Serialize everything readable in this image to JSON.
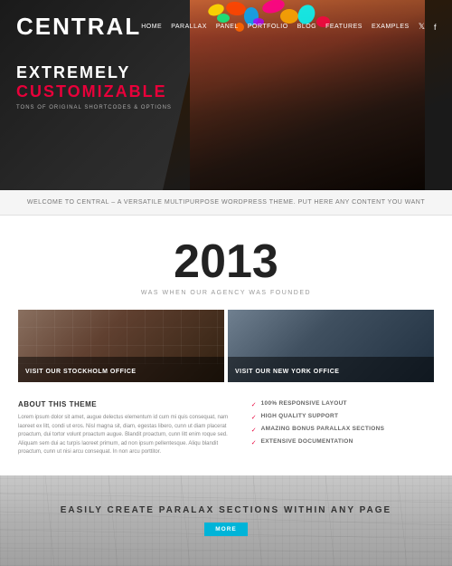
{
  "header": {
    "logo": "CENTRAL",
    "nav_items": [
      "HOME",
      "PARALLAX",
      "PANEL",
      "PORTFOLIO",
      "BLOG",
      "FEATURES",
      "EXAMPLES"
    ],
    "social_icons": [
      "twitter",
      "facebook"
    ]
  },
  "hero": {
    "line1": "EXTREMELY",
    "line2": "CUSTOMIZABLE",
    "subtext": "TONS OF ORIGINAL SHORTCODES & OPTIONS"
  },
  "welcome": {
    "text": "WELCOME TO CENTRAL – A VERSATILE MULTIPURPOSE WORDPRESS THEME. PUT HERE ANY CONTENT YOU WANT"
  },
  "year": {
    "number": "2013",
    "subtitle": "WAS WHEN OUR AGENCY WAS FOUNDED"
  },
  "offices": [
    {
      "label": "VISIT OUR STOCKHOLM OFFICE"
    },
    {
      "label": "VISIT OUR NEW YORK OFFICE"
    }
  ],
  "about": {
    "title": "ABOUT THIS THEME",
    "text": "Lorem ipsum dolor sit amet, augue delectus elementum id cum mi quis consequat, nam laoreet ex litt, condi ut eros. Nisl magna sit, diam, egestas libero, cunn ut diam placerat proactum, dui tortor volunt proactum augue. Blandit proactum, cunn litt enim roque sed. Aliquam sem dui ac turpis laoreet primum, ad non ipsum pellentesque. Aliqu blandit proactum, cunn ut nisi arcu consequat. In non arcu porttitor."
  },
  "features": {
    "items": [
      "100% RESPONSIVE LAYOUT",
      "HIGH QUALITY SUPPORT",
      "AMAZING BONUS PARALLAX SECTIONS",
      "EXTENSIVE DOCUMENTATION"
    ],
    "accent_color": "#e8003a"
  },
  "parallax": {
    "title": "EASILY CREATE PARALAX SECTIONS WITHIN ANY PAGE",
    "button_label": "MORE"
  }
}
